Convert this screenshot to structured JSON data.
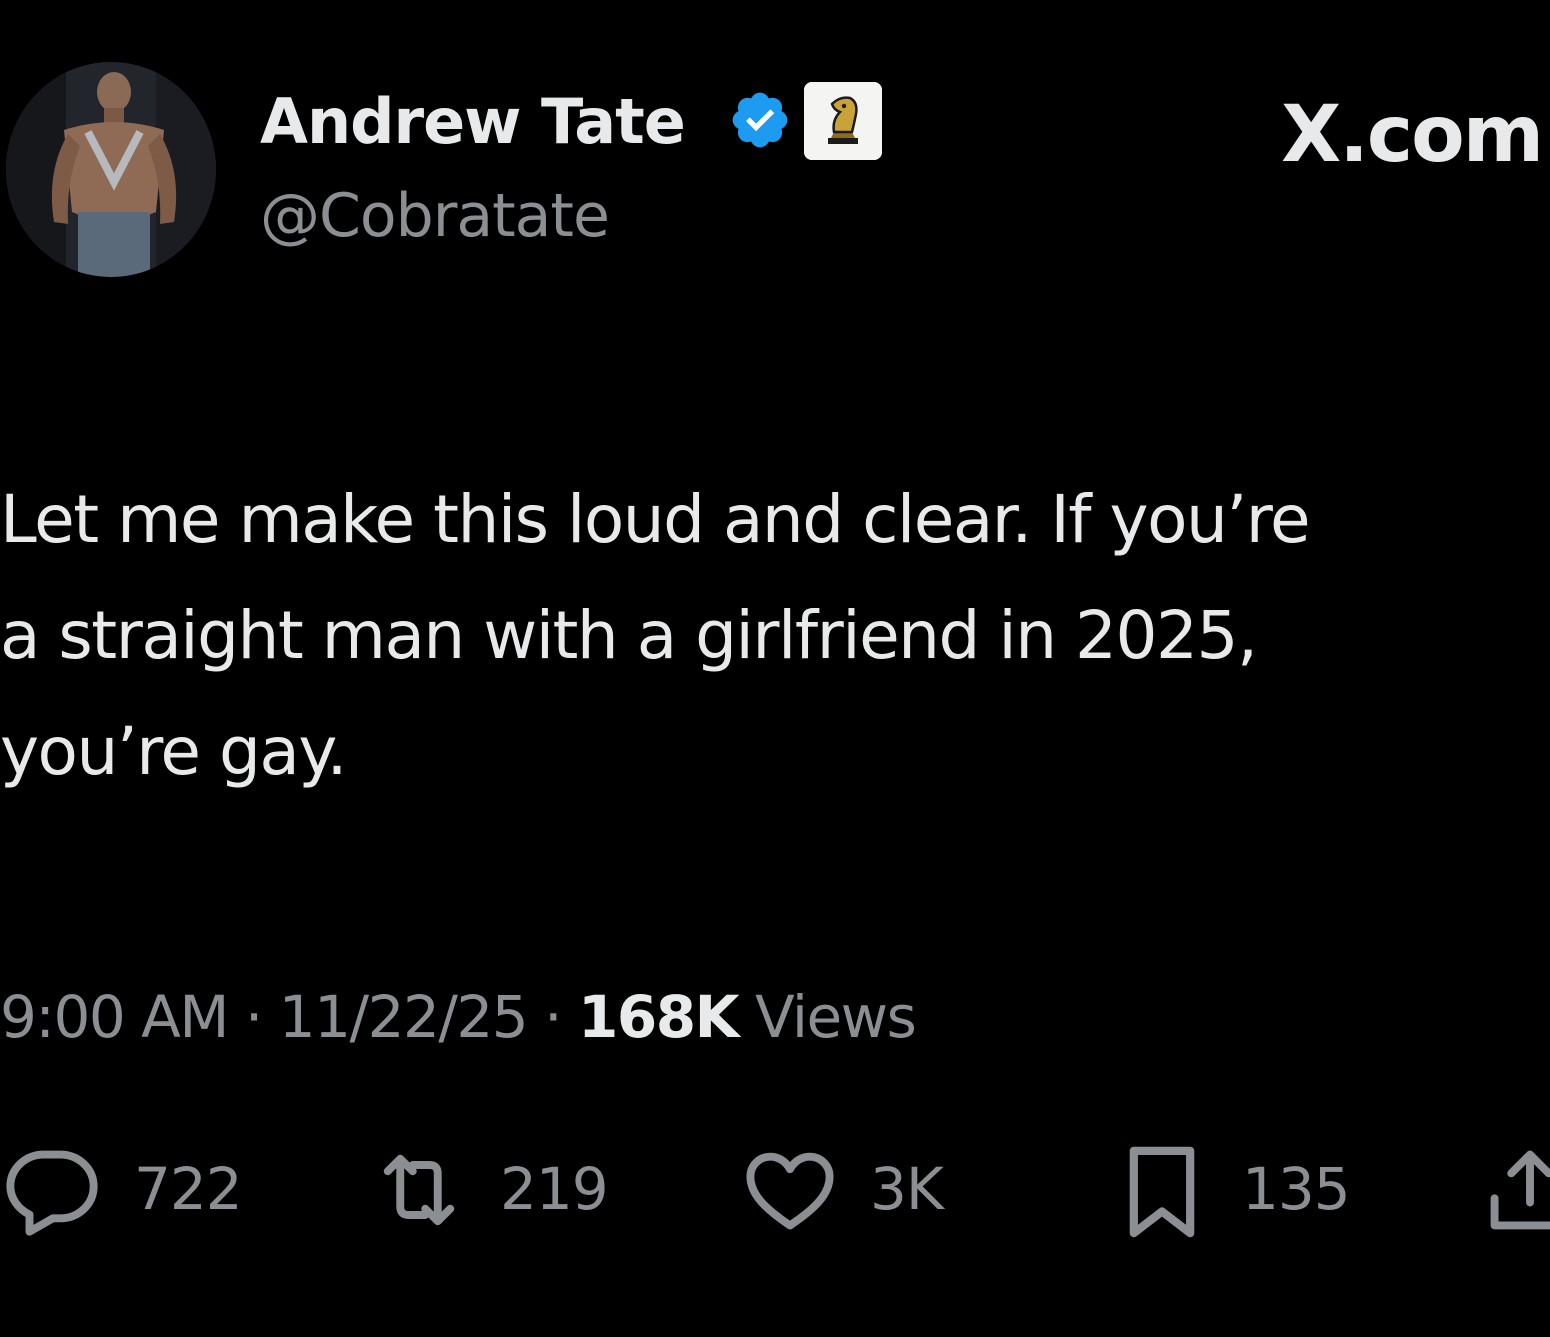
{
  "author": {
    "display_name": "Andrew Tate",
    "handle": "@Cobratate",
    "avatar_icon": "profile-photo",
    "verified_icon": "verified-badge-icon",
    "affiliate_icon": "chess-knight-badge-icon"
  },
  "site_mark": "X.com",
  "tweet": {
    "lines": [
      "Let me make this loud and clear. If you’re",
      "a straight man with a girlfriend in 2025,",
      "you’re gay."
    ]
  },
  "meta": {
    "time": "9:00 AM",
    "separator": "·",
    "date": "11/22/25",
    "views_count": "168K",
    "views_label": "Views"
  },
  "actions": {
    "replies": "722",
    "reposts": "219",
    "likes": "3K",
    "bookmarks": "135"
  },
  "colors": {
    "background": "#000000",
    "primary_text": "#e7e9ea",
    "secondary_text": "#8b8f94",
    "verified_blue": "#1d9bf0"
  }
}
